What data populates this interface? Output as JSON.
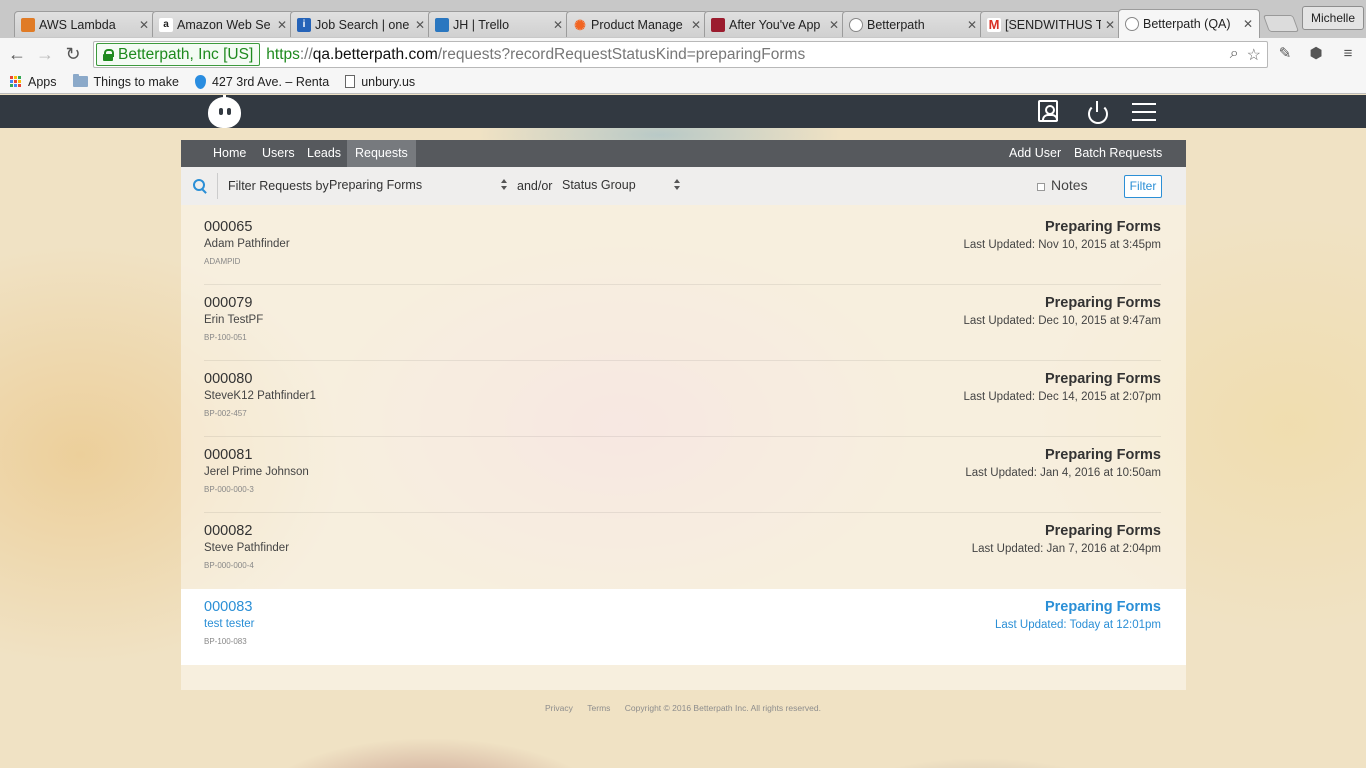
{
  "browser": {
    "tabs": [
      {
        "title": "AWS Lambda",
        "icon": "aws-icon",
        "color": "#e07b26"
      },
      {
        "title": "Amazon Web Se",
        "icon": "amazon-icon",
        "color": "#222222"
      },
      {
        "title": "Job Search | one",
        "icon": "info-icon",
        "color": "#2563b8"
      },
      {
        "title": "JH | Trello",
        "icon": "trello-icon",
        "color": "#2a77c0"
      },
      {
        "title": "Product Manage",
        "icon": "gear-icon",
        "color": "#f26522"
      },
      {
        "title": "After You've App",
        "icon": "brand-icon",
        "color": "#9b1c2e"
      },
      {
        "title": "Betterpath",
        "icon": "robot-icon",
        "color": "#888888"
      },
      {
        "title": "[SENDWITHUS TE",
        "icon": "gmail-icon",
        "color": "#d93025"
      },
      {
        "title": "Betterpath (QA)",
        "icon": "robot-icon",
        "color": "#888888"
      }
    ],
    "profile": "Michelle",
    "ev_label": "Betterpath, Inc [US]",
    "url": {
      "scheme": "https",
      "sep": "://",
      "host": "qa.betterpath.com",
      "path": "/requests?recordRequestStatusKind=preparingForms"
    },
    "bookmarks": [
      {
        "label": "Apps",
        "icon": "apps-icon"
      },
      {
        "label": "Things to make",
        "icon": "folder-icon"
      },
      {
        "label": "427 3rd Ave. – Renta",
        "icon": "map-pin-icon"
      },
      {
        "label": "unbury.us",
        "icon": "page-icon"
      }
    ]
  },
  "app": {
    "nav": {
      "home": "Home",
      "users": "Users",
      "leads": "Leads",
      "requests": "Requests",
      "add_user": "Add User",
      "batch_requests": "Batch Requests"
    },
    "filter": {
      "label": "Filter Requests by",
      "status_value": "Preparing Forms",
      "andor": "and/or",
      "group_value": "Status Group",
      "notes": "Notes",
      "button": "Filter"
    },
    "requests": [
      {
        "number": "000065",
        "name": "Adam Pathfinder",
        "code": "ADAMPID",
        "status": "Preparing Forms",
        "updated": "Last Updated: Nov 10, 2015 at 3:45pm"
      },
      {
        "number": "000079",
        "name": "Erin TestPF",
        "code": "BP-100-051",
        "status": "Preparing Forms",
        "updated": "Last Updated: Dec 10, 2015 at 9:47am"
      },
      {
        "number": "000080",
        "name": "SteveK12 Pathfinder1",
        "code": "BP-002-457",
        "status": "Preparing Forms",
        "updated": "Last Updated: Dec 14, 2015 at 2:07pm"
      },
      {
        "number": "000081",
        "name": "Jerel Prime Johnson",
        "code": "BP-000-000-3",
        "status": "Preparing Forms",
        "updated": "Last Updated: Jan 4, 2016 at 10:50am"
      },
      {
        "number": "000082",
        "name": "Steve Pathfinder",
        "code": "BP-000-000-4",
        "status": "Preparing Forms",
        "updated": "Last Updated: Jan 7, 2016 at 2:04pm"
      },
      {
        "number": "000083",
        "name": "test tester",
        "code": "BP-100-083",
        "status": "Preparing Forms",
        "updated": "Last Updated: Today at 12:01pm"
      }
    ],
    "footer": {
      "privacy": "Privacy",
      "terms": "Terms",
      "copyright": "Copyright © 2016 Betterpath Inc. All rights reserved."
    },
    "colors": {
      "accent": "#2b8fd6",
      "topbar": "#323941",
      "subnav": "#56595d"
    }
  }
}
